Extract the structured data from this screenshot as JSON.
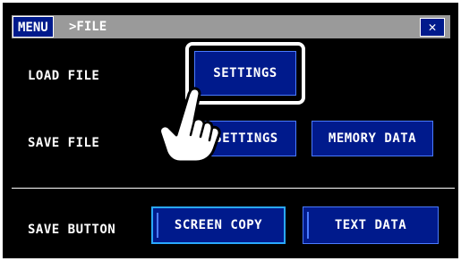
{
  "titlebar": {
    "menu_label": "MENU",
    "breadcrumb": ">FILE",
    "close_label": "✕"
  },
  "rows": {
    "load_file": {
      "label": "LOAD FILE",
      "buttons": [
        "SETTINGS"
      ]
    },
    "save_file": {
      "label": "SAVE FILE",
      "buttons": [
        "SETTINGS",
        "MEMORY DATA"
      ]
    },
    "save_button": {
      "label": "SAVE BUTTON",
      "buttons": [
        "SCREEN COPY",
        "TEXT DATA"
      ]
    }
  },
  "colors": {
    "button_bg": "#001a8c",
    "screen_bg": "#000000",
    "titlebar_bg": "#9a9a9a",
    "selected_border": "#29a8ff"
  },
  "icons": {
    "pointer": "pointing-hand-icon",
    "close": "close-icon"
  }
}
